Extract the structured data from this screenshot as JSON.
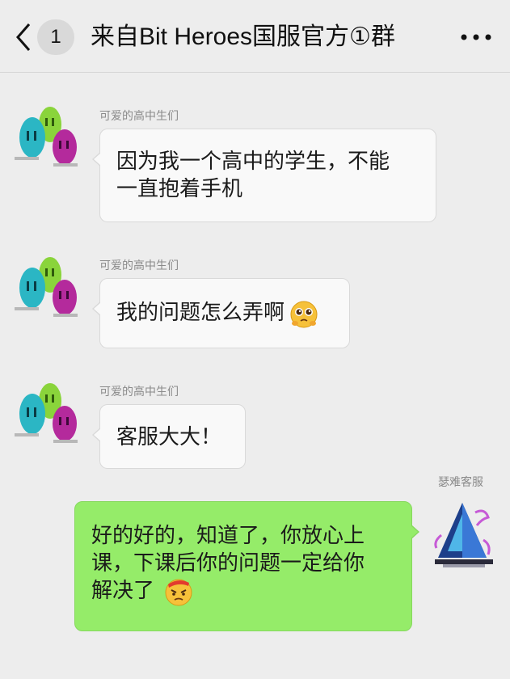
{
  "header": {
    "unread_count": "1",
    "title": "来自Bit Heroes国服官方①群"
  },
  "messages": [
    {
      "sender": "可爱的高中生们",
      "lines": [
        "因为我一个高中的学生，不能",
        "一直抱着手机"
      ]
    },
    {
      "sender": "可爱的高中生们",
      "lines": [
        "我的问题怎么弄啊"
      ],
      "emoji": "pleading-face-emoji"
    },
    {
      "sender": "可爱的高中生们",
      "lines": [
        "客服大大！"
      ]
    },
    {
      "sender": "瑟难客服",
      "lines": [
        "好的好的，知道了，你放心上",
        "课，下课后你的问题一定给你",
        "解决了"
      ],
      "emoji": "angry-face-emoji"
    }
  ],
  "colors": {
    "background": "#ededed",
    "incoming_bubble": "#f9f9f9",
    "outgoing_bubble": "#95ec69"
  }
}
